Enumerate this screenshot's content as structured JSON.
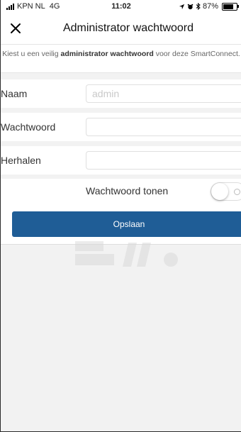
{
  "status_bar": {
    "carrier": "KPN NL",
    "network": "4G",
    "time": "11:02",
    "battery_text": "87%",
    "battery_level": 0.87
  },
  "header": {
    "title": "Administrator wachtwoord",
    "close_icon": "close-icon"
  },
  "description": {
    "prefix": "Kiest u een veilig ",
    "bold": "administrator wachtwoord",
    "suffix": " voor deze SmartConnect."
  },
  "form": {
    "name_label": "Naam",
    "name_placeholder": "admin",
    "password_label": "Wachtwoord",
    "password_value": "",
    "repeat_label": "Herhalen",
    "repeat_value": "",
    "show_password_label": "Wachtwoord tonen",
    "show_password_enabled": false
  },
  "actions": {
    "save_label": "Opslaan"
  },
  "colors": {
    "accent": "#1f5d96",
    "background": "#f2f2f2"
  }
}
